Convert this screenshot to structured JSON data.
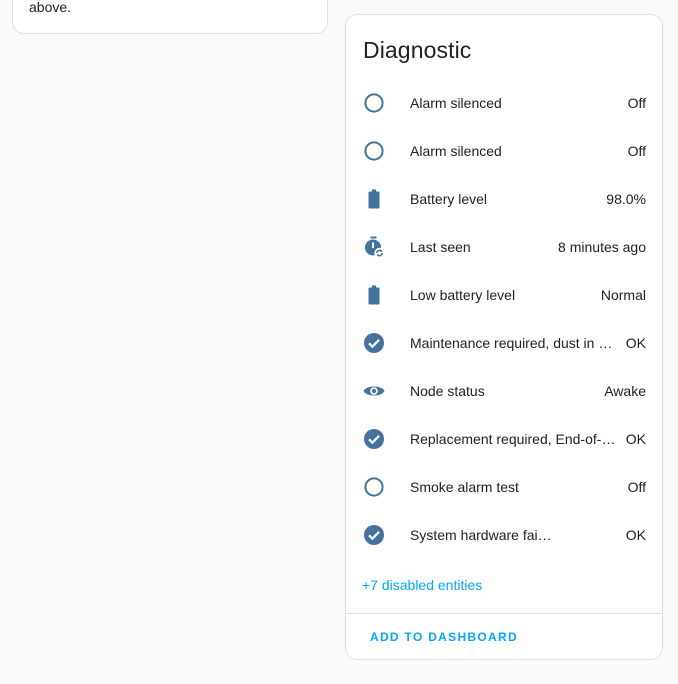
{
  "left_card": {
    "trailing_text": "above."
  },
  "diagnostic": {
    "title": "Diagnostic",
    "icon_color": "#44739e",
    "accent_color": "#03a9f4",
    "rows": [
      {
        "icon": "circle-outline-icon",
        "name": "Alarm silenced",
        "state": "Off"
      },
      {
        "icon": "circle-outline-icon",
        "name": "Alarm silenced",
        "state": "Off"
      },
      {
        "icon": "battery-icon",
        "name": "Battery level",
        "state": "98.0%"
      },
      {
        "icon": "timer-sync-icon",
        "name": "Last seen",
        "state": "8 minutes ago"
      },
      {
        "icon": "battery-icon",
        "name": "Low battery level",
        "state": "Normal"
      },
      {
        "icon": "check-circle-icon",
        "name": "Maintenance required, dust in d…",
        "state": "OK"
      },
      {
        "icon": "eye-icon",
        "name": "Node status",
        "state": "Awake"
      },
      {
        "icon": "check-circle-icon",
        "name": "Replacement required, End-of-li…",
        "state": "OK"
      },
      {
        "icon": "circle-outline-icon",
        "name": "Smoke alarm test",
        "state": "Off"
      },
      {
        "icon": "check-circle-icon",
        "name": "System hardware failure",
        "state": "OK"
      }
    ],
    "disabled_entities_link": "+7 disabled entities",
    "add_to_dashboard_label": "ADD TO DASHBOARD"
  }
}
